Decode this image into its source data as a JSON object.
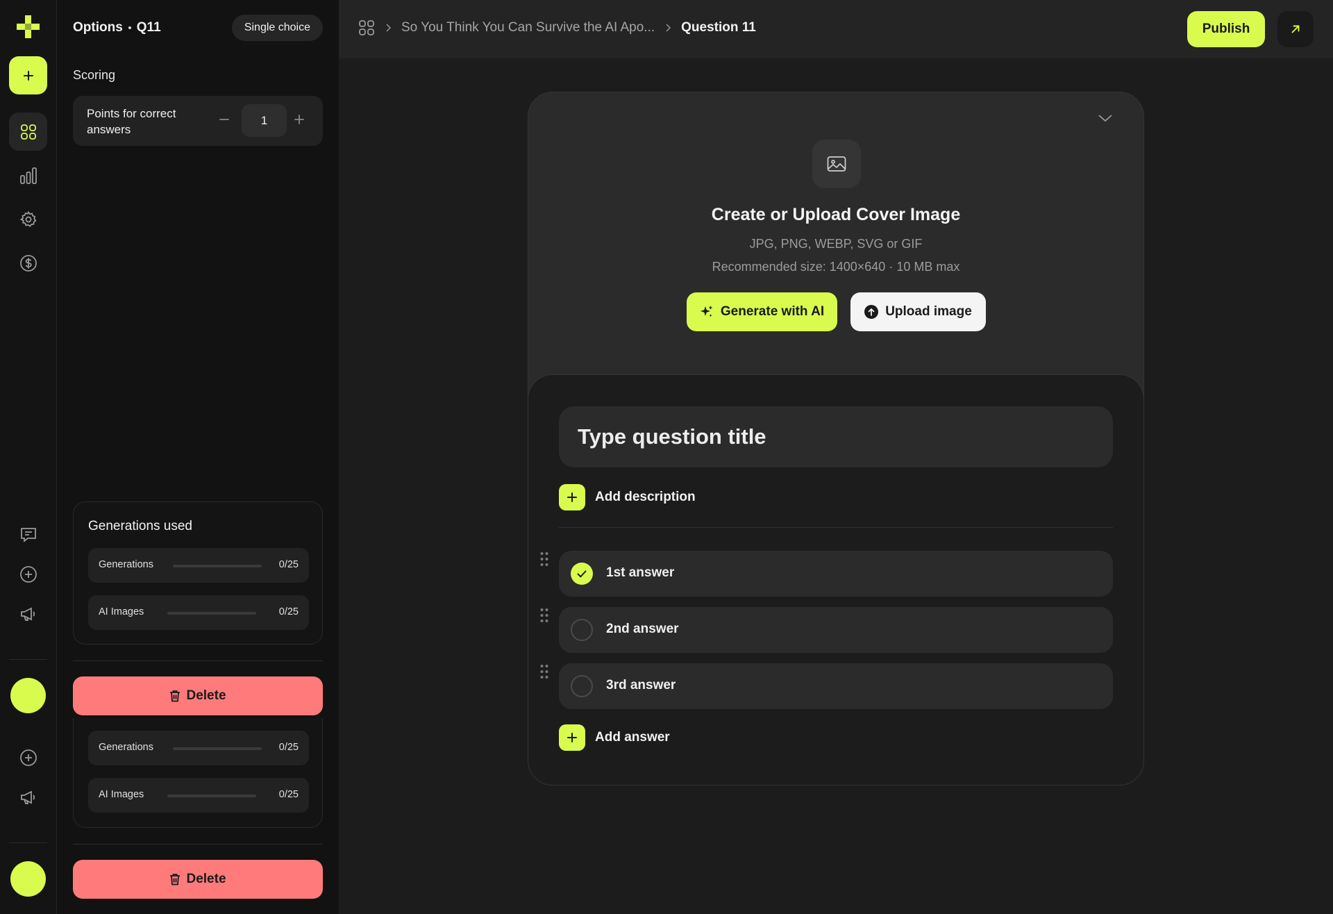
{
  "rail": {
    "logo_icon": "plus-cross-logo",
    "nav_icons": [
      "grid-icon",
      "bar-chart-icon",
      "gear-icon",
      "dollar-icon"
    ],
    "bottom_icons": [
      "chat-icon",
      "plus-circle-icon",
      "megaphone-icon"
    ],
    "accent": "#d9fb4e"
  },
  "panel": {
    "title_options": "Options",
    "title_question": "Q11",
    "type_pill": "Single choice",
    "scoring_label": "Scoring",
    "points_label": "Points for correct answers",
    "points_value": "1",
    "generations": {
      "title": "Generations used",
      "rows": [
        {
          "label": "Generations",
          "count": "0/25",
          "used": 0,
          "limit": 25
        },
        {
          "label": "AI Images",
          "count": "0/25",
          "used": 0,
          "limit": 25
        }
      ]
    },
    "generations_repeat": {
      "rows": [
        {
          "label": "Generations",
          "count": "0/25",
          "used": 0,
          "limit": 25
        },
        {
          "label": "AI Images",
          "count": "0/25",
          "used": 0,
          "limit": 25
        }
      ]
    },
    "delete_label": "Delete",
    "delete_color": "#ff7b7b"
  },
  "topbar": {
    "breadcrumb_quiz": "So You Think You Can Survive the AI Apo...",
    "breadcrumb_current": "Question 11",
    "publish_label": "Publish"
  },
  "cover": {
    "title": "Create or Upload Cover Image",
    "formats": "JPG, PNG, WEBP, SVG or GIF",
    "recommended": "Recommended size: 1400×640 · 10 MB max",
    "generate_label": "Generate with AI",
    "upload_label": "Upload image"
  },
  "question": {
    "title_placeholder": "Type question title",
    "add_description_label": "Add description",
    "answers": [
      {
        "text": "1st answer",
        "correct": true
      },
      {
        "text": "2nd answer",
        "correct": false
      },
      {
        "text": "3rd answer",
        "correct": false
      }
    ],
    "add_answer_label": "Add answer"
  }
}
